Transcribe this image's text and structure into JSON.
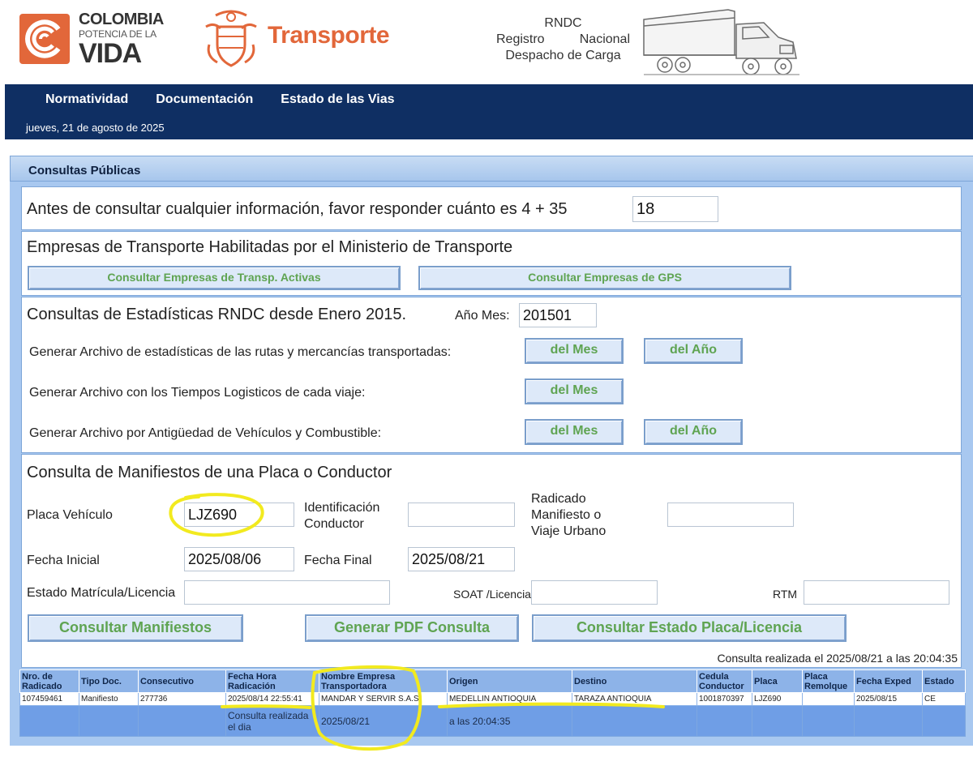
{
  "header": {
    "logo_line1": "COLOMBIA",
    "logo_line2": "POTENCIA DE LA",
    "logo_line3": "VIDA",
    "ministry": "Transporte",
    "rndc_line1": "RNDC",
    "rndc_line2a": "Registro",
    "rndc_line2b": "Nacional",
    "rndc_line3": "Despacho de Carga",
    "colors": {
      "brand_orange": "#e2673a",
      "nav_blue": "#0f2f63",
      "button_text": "#5fa452"
    }
  },
  "nav": {
    "items": [
      {
        "label": "Normatividad"
      },
      {
        "label": "Documentación"
      },
      {
        "label": "Estado de las Vias"
      }
    ],
    "date": "jueves, 21 de agosto de 2025"
  },
  "panel": {
    "title": "Consultas Públicas"
  },
  "captcha": {
    "question": "Antes de consultar cualquier información, favor responder cuánto es 4 + 35",
    "answer": "18"
  },
  "empresas": {
    "title": "Empresas de Transporte Habilitadas por el Ministerio de Transporte",
    "btn_activas": "Consultar Empresas de Transp. Activas",
    "btn_gps": "Consultar Empresas de GPS"
  },
  "estadisticas": {
    "title": "Consultas de Estadísticas RNDC desde Enero 2015.",
    "anio_mes_label": "Año Mes:",
    "anio_mes_value": "201501",
    "row1_label": "Generar Archivo de estadísticas de las rutas y mercancías transportadas:",
    "row2_label": "Generar Archivo con los Tiempos Logisticos de cada viaje:",
    "row3_label": "Generar Archivo por Antigüedad de Vehículos y Combustible:",
    "btn_mes": "del Mes",
    "btn_anio": "del Año"
  },
  "manifiestos": {
    "title": "Consulta de Manifiestos de una Placa o Conductor",
    "placa_label": "Placa Vehículo",
    "placa_value": "LJZ690",
    "id_label_1": "Identificación",
    "id_label_2": "Conductor",
    "id_value": "",
    "radicado_label_1": "Radicado",
    "radicado_label_2": "Manifiesto o",
    "radicado_label_3": "Viaje Urbano",
    "radicado_value": "",
    "fecha_inicial_label": "Fecha Inicial",
    "fecha_inicial_value": "2025/08/06",
    "fecha_final_label": "Fecha Final",
    "fecha_final_value": "2025/08/21",
    "estado_label": "Estado Matrícula/Licencia",
    "estado_value": "",
    "soat_label": "SOAT /Licencia",
    "soat_value": "",
    "rtm_label": "RTM",
    "rtm_value": "",
    "btn_consultar": "Consultar Manifiestos",
    "btn_pdf": "Generar PDF Consulta",
    "btn_estado": "Consultar Estado Placa/Licencia",
    "consulta_note": "Consulta realizada el 2025/08/21 a las 20:04:35"
  },
  "results": {
    "headers": [
      "Nro. de Radicado",
      "Tipo Doc.",
      "Consecutivo",
      "Fecha Hora Radicación",
      "Nombre Empresa Transportadora",
      "Origen",
      "Destino",
      "Cedula Conductor",
      "Placa",
      "Placa Remolque",
      "Fecha Exped",
      "Estado"
    ],
    "rows": [
      [
        "107459461",
        "Manifiesto",
        "277736",
        "2025/08/14 22:55:41",
        "MANDAR Y SERVIR S.A.S.",
        "MEDELLIN ANTIOQUIA",
        "TARAZA ANTIOQUIA",
        "1001870397",
        "LJZ690",
        "",
        "2025/08/15",
        "CE"
      ]
    ],
    "footer": {
      "label": "Consulta realizada el dia",
      "date": "2025/08/21",
      "time": "a las 20:04:35"
    }
  }
}
